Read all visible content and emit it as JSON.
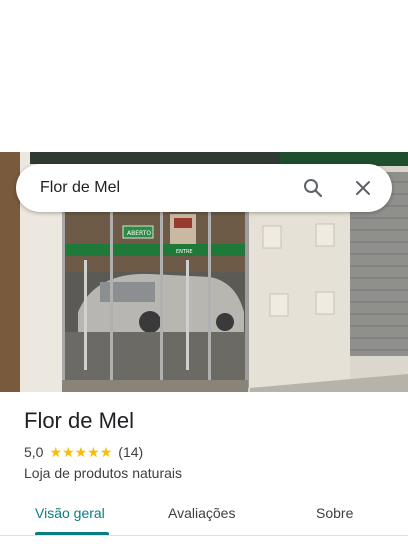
{
  "search": {
    "query": "Flor de Mel"
  },
  "icons": {
    "search": "search-icon",
    "close": "close-icon",
    "star": "star-icon"
  },
  "photo": {
    "sign_open": "ABERTO",
    "sign_enter": "ENTRE"
  },
  "place": {
    "name": "Flor de Mel",
    "rating": "5,0",
    "stars": 5,
    "reviews": "(14)",
    "category": "Loja de produtos naturais"
  },
  "tabs": [
    {
      "label": "Visão geral",
      "active": true
    },
    {
      "label": "Avaliações",
      "active": false
    },
    {
      "label": "Sobre",
      "active": false
    }
  ],
  "colors": {
    "accent": "#0b7c82",
    "star": "#fbbc04"
  }
}
